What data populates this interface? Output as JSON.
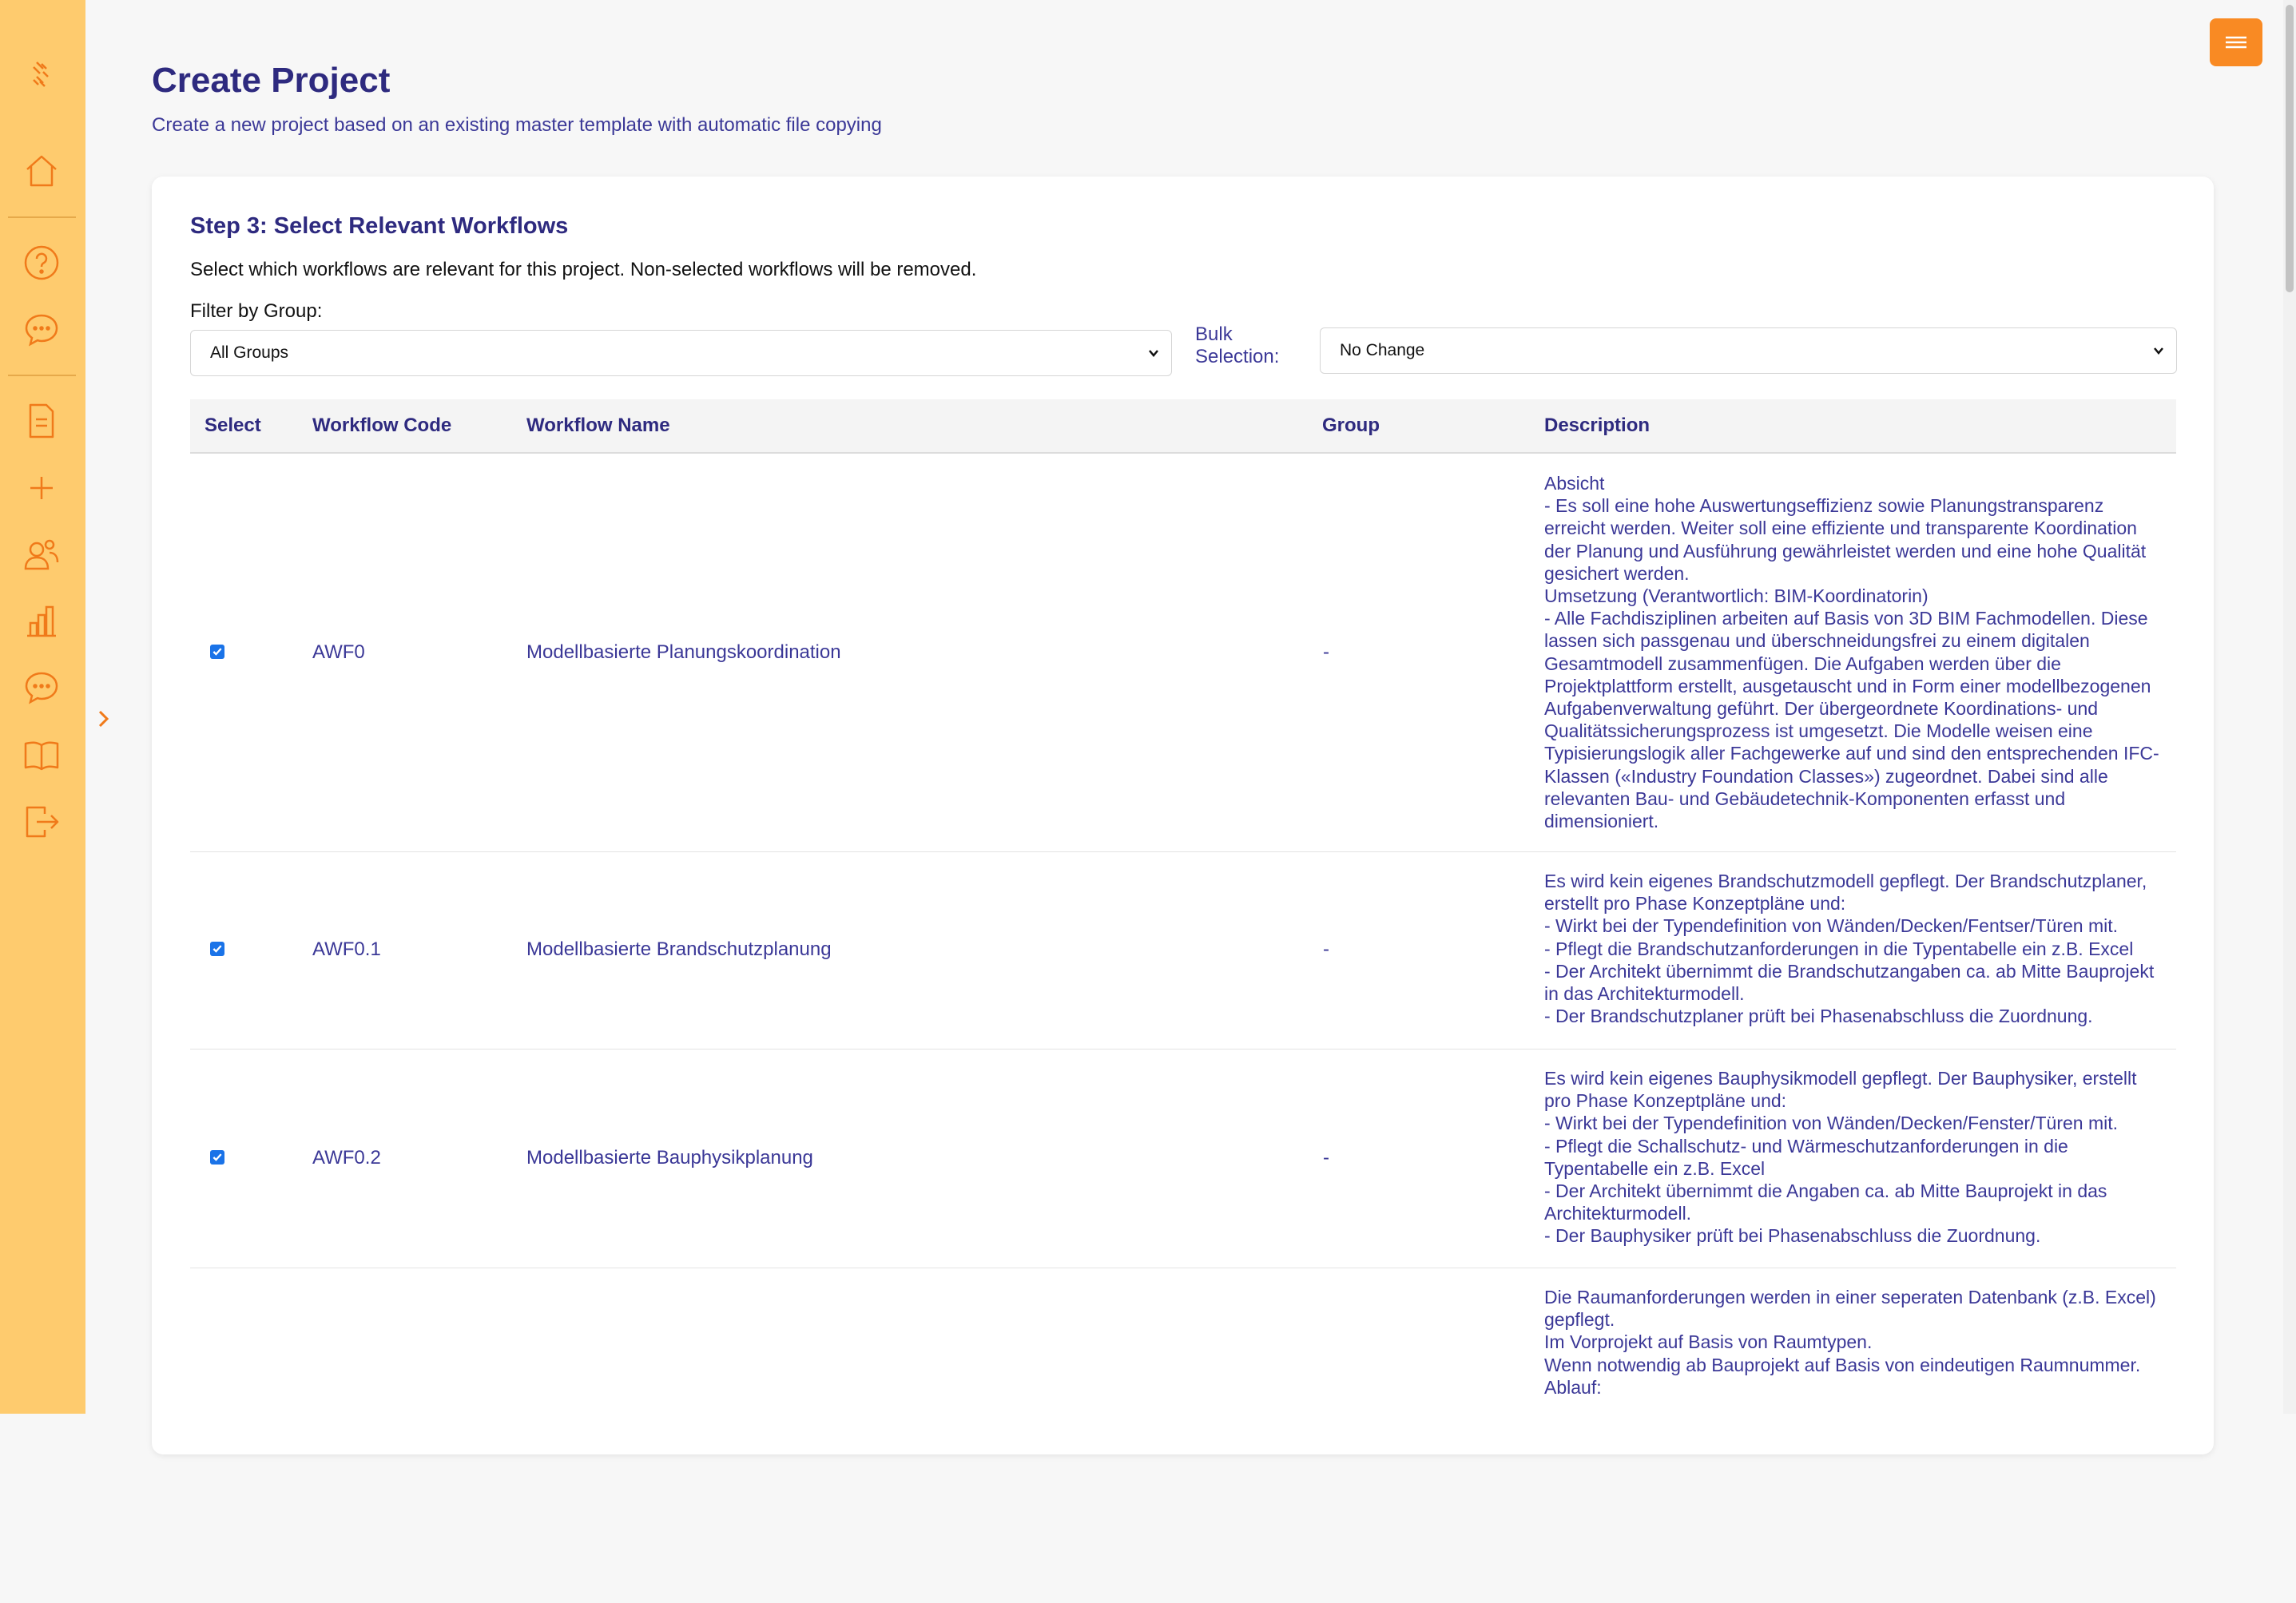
{
  "sidebar": {
    "icons": [
      "logo-icon",
      "home-icon",
      "help-icon",
      "chat-icon",
      "document-icon",
      "plus-icon",
      "users-icon",
      "bar-chart-icon",
      "chat-icon",
      "book-icon",
      "logout-icon",
      "chevron-right-icon"
    ]
  },
  "header": {
    "title": "Create Project",
    "subtitle": "Create a new project based on an existing master template with automatic file copying"
  },
  "step": {
    "title": "Step 3: Select Relevant Workflows",
    "description": "Select which workflows are relevant for this project. Non-selected workflows will be removed."
  },
  "filter": {
    "label": "Filter by Group:",
    "value": "All Groups"
  },
  "bulk": {
    "label": "Bulk Selection:",
    "value": "No Change"
  },
  "table": {
    "headers": [
      "Select",
      "Workflow Code",
      "Workflow Name",
      "Group",
      "Description"
    ],
    "rows": [
      {
        "selected": true,
        "code": "AWF0",
        "name": "Modellbasierte Planungskoordination",
        "group": "-",
        "description": "Absicht\n- Es soll eine hohe Auswertungseffizienz sowie Planungstransparenz erreicht werden. Weiter soll eine effiziente und transparente Koordination der Planung und Ausführung gewährleistet werden und eine hohe Qualität gesichert werden.\nUmsetzung (Verantwortlich: BIM-Koordinatorin)\n- Alle Fachdisziplinen arbeiten auf Basis von 3D BIM Fachmodellen. Diese lassen sich passgenau und überschneidungsfrei zu einem digitalen Gesamtmodell zusammenfügen. Die Aufgaben werden über die Projektplattform erstellt, ausgetauscht und in Form einer modellbezogenen Aufgabenverwaltung geführt. Der übergeordnete Koordinations- und Qualitätssicherungsprozess ist umgesetzt. Die Modelle weisen eine Typisierungslogik aller Fachgewerke auf und sind den entsprechenden IFC-Klassen («Industry Foundation Classes») zugeordnet. Dabei sind alle relevanten Bau- und Gebäudetechnik-Komponenten erfasst und dimensioniert."
      },
      {
        "selected": true,
        "code": "AWF0.1",
        "name": "Modellbasierte Brandschutzplanung",
        "group": "-",
        "description": "Es wird kein eigenes Brandschutzmodell gepflegt. Der Brandschutzplaner, erstellt pro Phase Konzeptpläne und:\n- Wirkt bei der Typendefinition von Wänden/Decken/Fentser/Türen mit.\n- Pflegt die Brandschutzanforderungen in die Typentabelle ein z.B. Excel\n- Der Architekt übernimmt die Brandschutzangaben ca. ab Mitte Bauprojekt in das Architekturmodell.\n- Der Brandschutzplaner prüft bei Phasenabschluss die Zuordnung."
      },
      {
        "selected": true,
        "code": "AWF0.2",
        "name": "Modellbasierte Bauphysikplanung",
        "group": "-",
        "description": "Es wird kein eigenes Bauphysikmodell gepflegt. Der Bauphysiker, erstellt pro Phase Konzeptpläne und:\n- Wirkt bei der Typendefinition von Wänden/Decken/Fenster/Türen mit.\n- Pflegt die Schallschutz- und Wärmeschutzanforderungen in die Typentabelle ein z.B. Excel\n- Der Architekt übernimmt die Angaben ca. ab Mitte Bauprojekt in das Architekturmodell.\n- Der Bauphysiker prüft bei Phasenabschluss die Zuordnung."
      },
      {
        "selected": null,
        "code": "",
        "name": "",
        "group": "",
        "description": "Die Raumanforderungen werden in einer seperaten Datenbank (z.B. Excel) gepflegt.\nIm Vorprojekt auf Basis von Raumtypen.\nWenn notwendig ab Bauprojekt auf Basis von eindeutigen Raumnummer.\nAblauf:"
      }
    ]
  },
  "colors": {
    "sidebar_bg": "#fecb6e",
    "accent_orange": "#f98a23",
    "title_navy": "#2e2a7f",
    "text_indigo": "#3b3897",
    "checkbox_blue": "#1a73e8"
  }
}
